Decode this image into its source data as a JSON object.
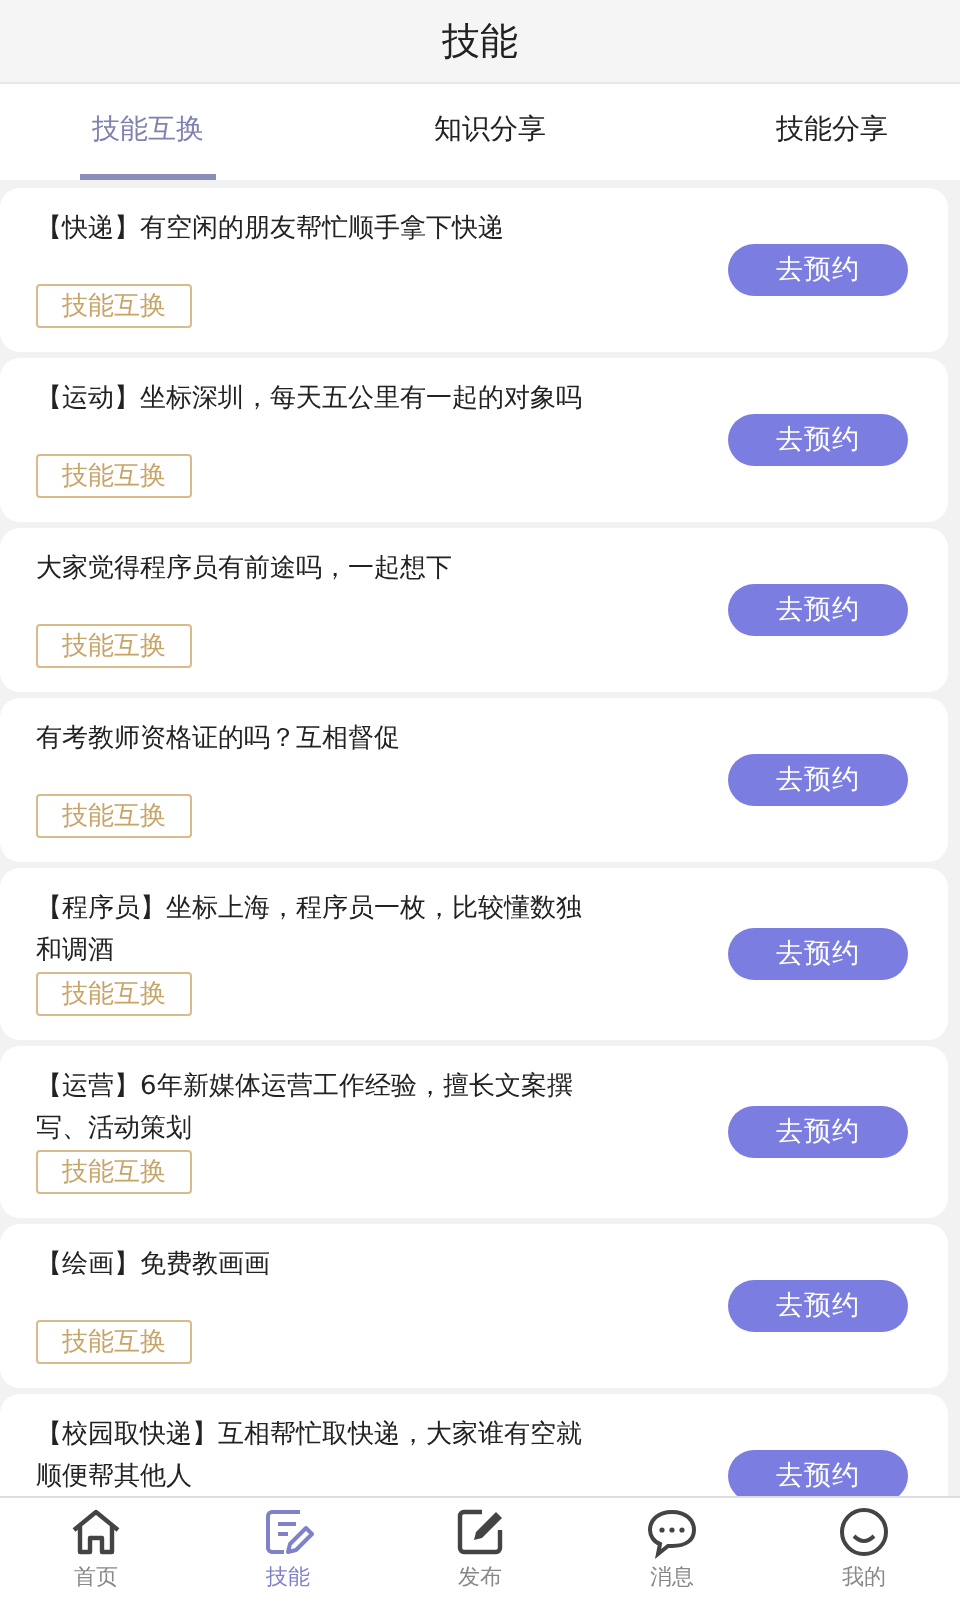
{
  "header": {
    "title": "技能"
  },
  "tabs": [
    {
      "label": "技能互换",
      "selected": true
    },
    {
      "label": "知识分享",
      "selected": false
    },
    {
      "label": "技能分享",
      "selected": false
    }
  ],
  "posts": [
    {
      "title": "【快递】有空闲的朋友帮忙顺手拿下快递",
      "tag": "技能互换",
      "action": "去预约"
    },
    {
      "title": "【运动】坐标深圳，每天五公里有一起的对象吗",
      "tag": "技能互换",
      "action": "去预约"
    },
    {
      "title": "大家觉得程序员有前途吗，一起想下",
      "tag": "技能互换",
      "action": "去预约"
    },
    {
      "title": "有考教师资格证的吗？互相督促",
      "tag": "技能互换",
      "action": "去预约"
    },
    {
      "title": "【程序员】坐标上海，程序员一枚，比较懂数独和调酒",
      "tag": "技能互换",
      "action": "去预约"
    },
    {
      "title": "【运营】6年新媒体运营工作经验，擅长文案撰写、活动策划",
      "tag": "技能互换",
      "action": "去预约"
    },
    {
      "title": "【绘画】免费教画画",
      "tag": "技能互换",
      "action": "去预约"
    },
    {
      "title": "【校园取快递】互相帮忙取快递，大家谁有空就顺便帮其他人",
      "action": "去预约"
    }
  ],
  "nav": [
    {
      "kind": "home",
      "label": "首页",
      "selected": false
    },
    {
      "kind": "skills",
      "label": "技能",
      "selected": true
    },
    {
      "kind": "publish",
      "label": "发布",
      "selected": false
    },
    {
      "kind": "messages",
      "label": "消息",
      "selected": false
    },
    {
      "kind": "profile",
      "label": "我的",
      "selected": false
    }
  ]
}
